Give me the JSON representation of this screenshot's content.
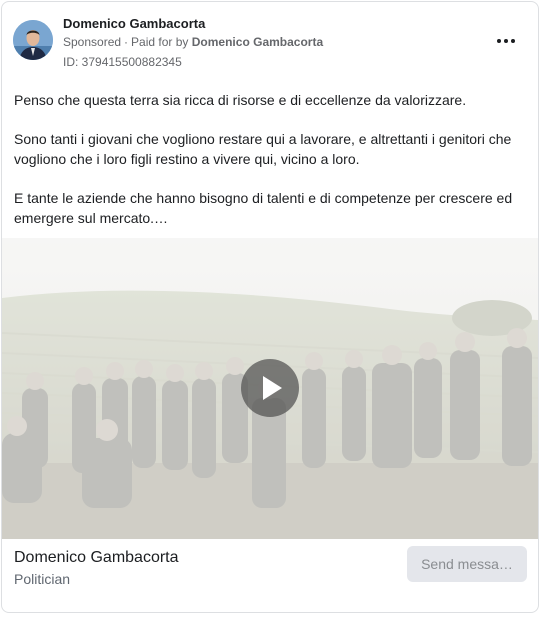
{
  "post": {
    "author": "Domenico Gambacorta",
    "sponsored": "Sponsored",
    "paid_for_prefix": "Paid for by",
    "paid_for_by": "Domenico Gambacorta",
    "id_text": "ID: 379415500882345",
    "paragraphs": [
      "Penso che questa terra sia ricca di risorse e di eccellenze da valorizzare.",
      "Sono tanti i giovani che vogliono restare qui a lavorare, e altrettanti i genitori che vogliono che i loro figli restino a vivere qui, vicino a loro.",
      "E tante le aziende che hanno bisogno di talenti e di competenze per crescere ed emergere sul mercato.…"
    ]
  },
  "footer": {
    "page_name": "Domenico Gambacorta",
    "page_category": "Politician",
    "cta_label": "Send messa…"
  },
  "icons": {
    "more": "more-options-icon",
    "play": "play-icon"
  },
  "colors": {
    "text_primary": "#1c1e21",
    "text_secondary": "#65676b",
    "button_bg": "#e4e6eb",
    "button_text": "#8a8d91"
  }
}
